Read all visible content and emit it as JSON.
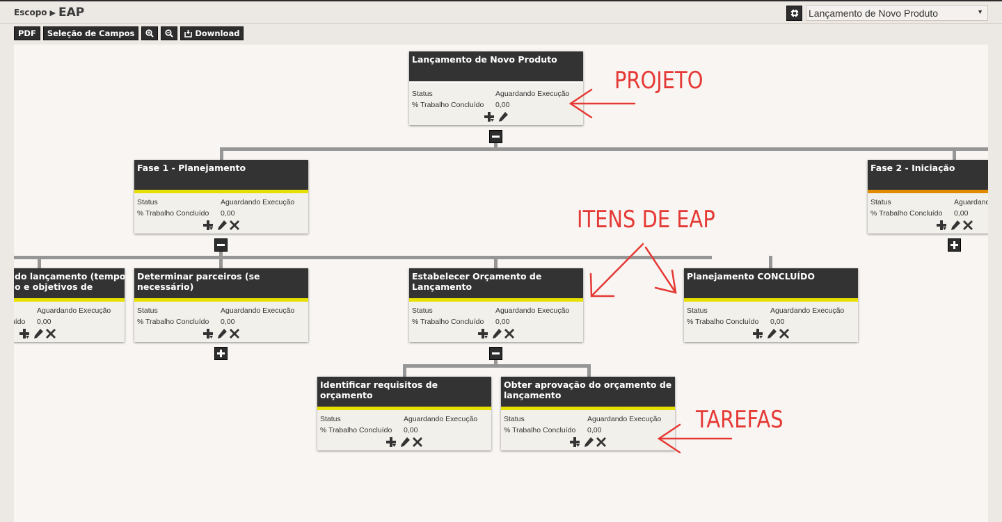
{
  "breadcrumb": {
    "parent": "Escopo",
    "separator": "▶",
    "current": "EAP"
  },
  "project_selector": {
    "icon": "target-icon",
    "selected": "Lançamento de Novo Produto"
  },
  "toolbar": {
    "pdf_label": "PDF",
    "fields_label": "Seleção de Campos",
    "zoom_in_icon": "zoom-in-icon",
    "zoom_out_icon": "zoom-out-icon",
    "download_label": "Download"
  },
  "labels": {
    "status": "Status",
    "progress": "% Trabalho Concluído"
  },
  "colors": {
    "header": "#333333",
    "stripe_yellow": "#e6e000",
    "stripe_orange": "#e08a00",
    "annotation": "#e53935",
    "connector": "#969696"
  },
  "nodes": {
    "root": {
      "title": "Lançamento de Novo Produto",
      "status": "Aguardando Execução",
      "progress": "0,00"
    },
    "fase1": {
      "title": "Fase 1 - Planejamento",
      "status": "Aguardando Execução",
      "progress": "0,00"
    },
    "fase2": {
      "title": "Fase 2 - Iniciação",
      "status": "Aguardando Execução",
      "progress": "0,00"
    },
    "item_left": {
      "title": "Definir metas do lançamento (tempo de lançamento e objetivos de",
      "title_visible": "do lançamento (tempo\no e objetivos de",
      "status": "Aguardando Execução",
      "progress": "0,00"
    },
    "parceiros": {
      "title": "Determinar parceiros (se necessário)",
      "status": "Aguardando Execução",
      "progress": "0,00"
    },
    "orcamento": {
      "title": "Estabelecer Orçamento de Lançamento",
      "status": "Aguardando Execução",
      "progress": "0,00"
    },
    "concluido": {
      "title": "Planejamento CONCLUÍDO",
      "status": "Aguardando Execução",
      "progress": "0,00"
    },
    "requisitos": {
      "title": "Identificar requisitos de orçamento",
      "status": "Aguardando Execução",
      "progress": "0,00"
    },
    "aprovacao": {
      "title": "Obter aprovação do orçamento de lançamento",
      "status": "Aguardando Execução",
      "progress": "0,00"
    }
  },
  "annotations": {
    "projeto": "PROJETO",
    "itens": "ITENS DE EAP",
    "tarefas": "TAREFAS"
  }
}
